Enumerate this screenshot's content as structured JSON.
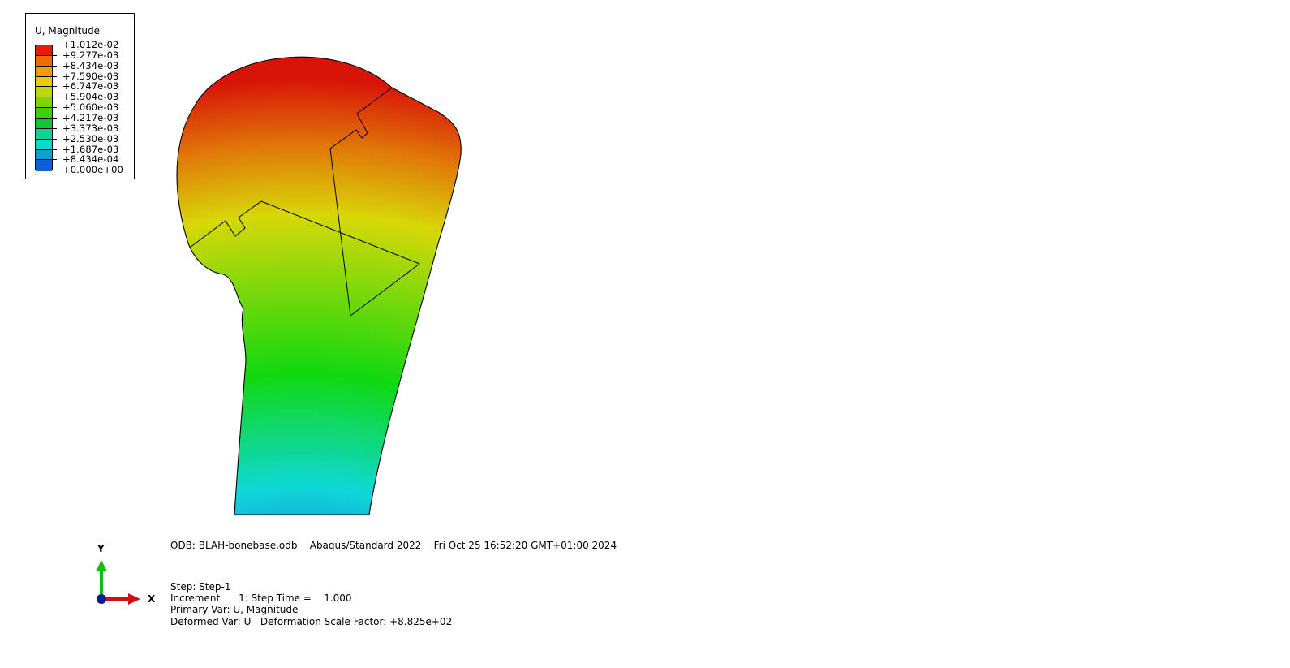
{
  "legend": {
    "title": "U, Magnitude",
    "levels": [
      {
        "label": "+1.012e-02",
        "color": "#e8190f"
      },
      {
        "label": "+9.277e-03",
        "color": "#f06a08"
      },
      {
        "label": "+8.434e-03",
        "color": "#f09e0a"
      },
      {
        "label": "+7.590e-03",
        "color": "#e8cc08"
      },
      {
        "label": "+6.747e-03",
        "color": "#bcd80a"
      },
      {
        "label": "+5.904e-03",
        "color": "#7fd40a"
      },
      {
        "label": "+5.060e-03",
        "color": "#3fcf0f"
      },
      {
        "label": "+4.217e-03",
        "color": "#0fc831"
      },
      {
        "label": "+3.373e-03",
        "color": "#0fd392"
      },
      {
        "label": "+2.530e-03",
        "color": "#0fd9cf"
      },
      {
        "label": "+1.687e-03",
        "color": "#0f9ed4"
      },
      {
        "label": "+8.434e-04",
        "color": "#105fd6"
      },
      {
        "label": "+0.000e+00",
        "color": "#0b17db"
      }
    ]
  },
  "info": {
    "odb_line": "ODB: BLAH-bonebase.odb    Abaqus/Standard 2022    Fri Oct 25 16:52:20 GMT+01:00 2024",
    "step_line": "Step: Step-1",
    "increment_line": "Increment      1: Step Time =    1.000",
    "primary_var_line": "Primary Var: U, Magnitude",
    "deformed_var_line": "Deformed Var: U   Deformation Scale Factor: +8.825e+02"
  },
  "triad": {
    "x_label": "X",
    "y_label": "Y",
    "x_color": "#cc1010",
    "y_color": "#10c010",
    "origin_color": "#0a1a9c"
  },
  "contour_colors": {
    "top": "#d81408",
    "orange": "#e07a08",
    "yellow": "#d7d808",
    "green": "#10d80f",
    "cyan": "#0fd8d8",
    "blue_mid": "#1e6be0",
    "bottom": "#0a14d6"
  }
}
